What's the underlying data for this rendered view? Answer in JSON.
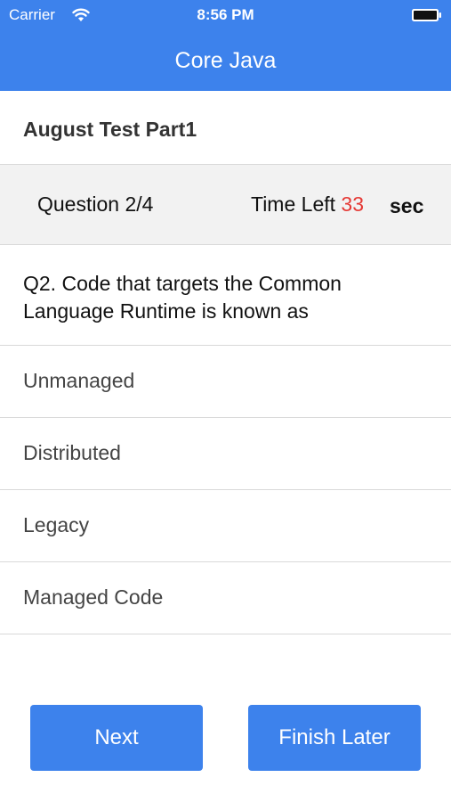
{
  "status_bar": {
    "carrier": "Carrier",
    "time": "8:56 PM",
    "wifi_icon": "wifi-icon",
    "battery_icon": "battery-icon"
  },
  "nav": {
    "title": "Core Java"
  },
  "test": {
    "name": "August Test Part1"
  },
  "info": {
    "question_counter": "Question 2/4",
    "time_left_label": "Time Left",
    "seconds_left": "33",
    "seconds_unit": "sec",
    "seconds_color": "#e53935"
  },
  "question": {
    "text": "Q2. Code that targets the Common Language Runtime is known as"
  },
  "options": [
    {
      "label": "Unmanaged"
    },
    {
      "label": "Distributed"
    },
    {
      "label": "Legacy"
    },
    {
      "label": "Managed Code"
    }
  ],
  "buttons": {
    "next_label": "Next",
    "finish_later_label": "Finish Later"
  },
  "colors": {
    "accent": "#3d82ec"
  }
}
